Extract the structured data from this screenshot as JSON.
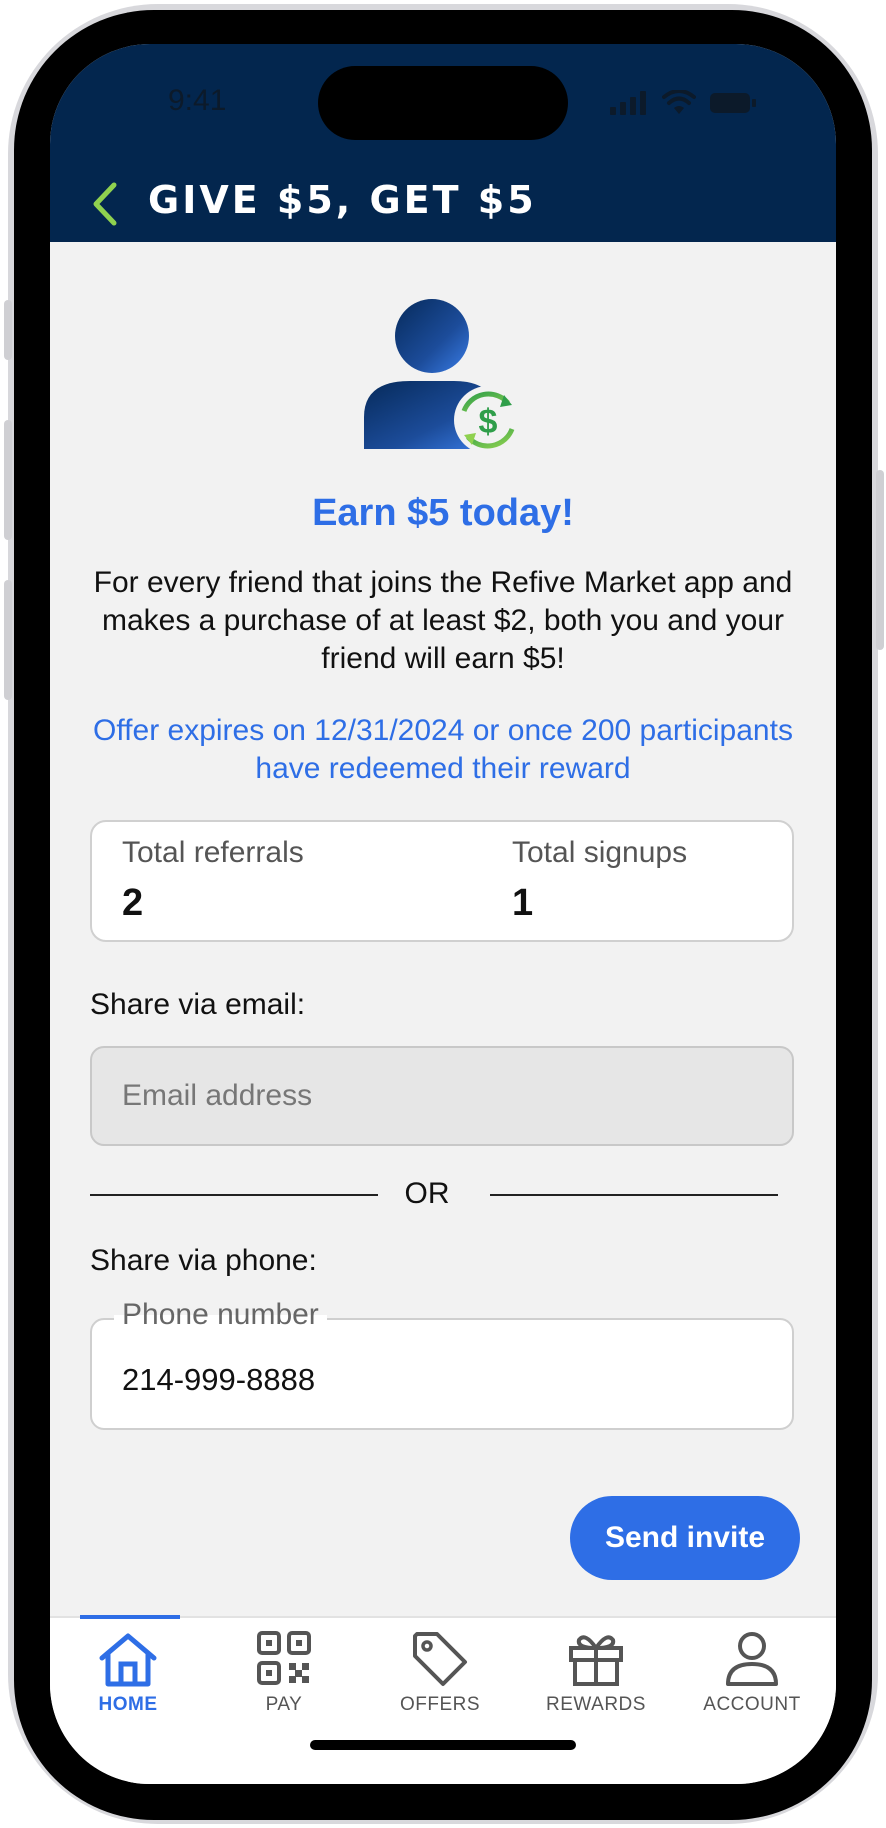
{
  "status_bar": {
    "time": "9:41"
  },
  "header": {
    "title": "GIVE $5, GET $5"
  },
  "hero": {
    "title": "Earn $5 today!",
    "description": "For every friend that joins the Refive Market app and makes a purchase of at least $2, both you and your friend will earn $5!",
    "offer_note": "Offer expires on 12/31/2024 or once 200 participants have redeemed their reward"
  },
  "stats": {
    "referrals_label": "Total referrals",
    "referrals_value": "2",
    "signups_label": "Total signups",
    "signups_value": "1"
  },
  "email_share": {
    "label": "Share via email:",
    "placeholder": "Email address"
  },
  "divider": {
    "text": "OR"
  },
  "phone_share": {
    "label": "Share via phone:",
    "field_label": "Phone number",
    "value": "214-999-8888"
  },
  "actions": {
    "send_label": "Send invite"
  },
  "nav": {
    "home": "HOME",
    "pay": "PAY",
    "offers": "OFFERS",
    "rewards": "REWARDS",
    "account": "ACCOUNT"
  },
  "colors": {
    "header_bg": "#03264e",
    "accent": "#2e6ee6",
    "back_arrow": "#8fd14f",
    "screen_bg": "#f2f2f2"
  },
  "icons": {
    "back": "chevron-left-icon",
    "hero": "user-refresh-dollar-icon",
    "home": "home-icon",
    "pay": "qr-code-icon",
    "offers": "tag-icon",
    "rewards": "gift-icon",
    "account": "person-icon"
  }
}
